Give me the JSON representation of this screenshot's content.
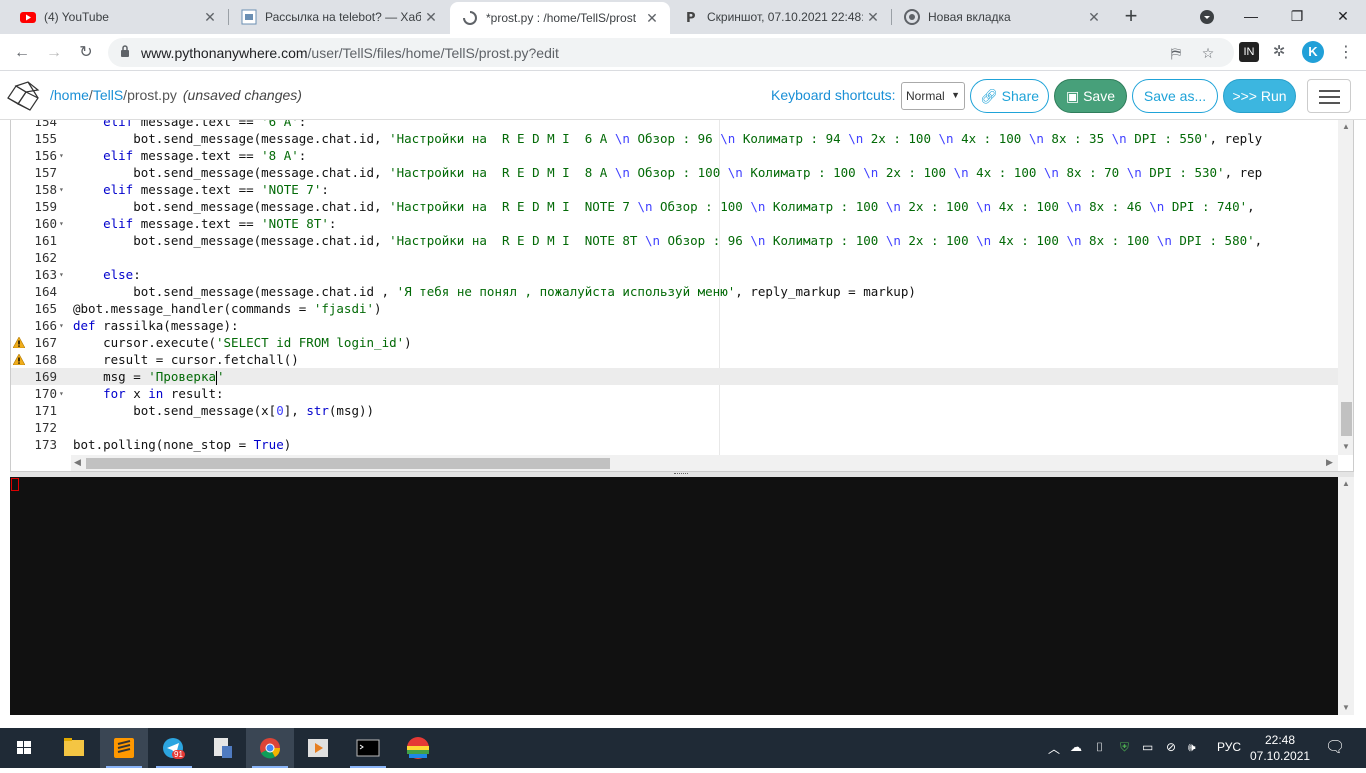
{
  "browser": {
    "tabs": [
      {
        "title": "(4) YouTube",
        "favicon": "youtube-icon"
      },
      {
        "title": "Рассылка на telebot? — Хабр",
        "favicon": "habr-icon"
      },
      {
        "title": "*prost.py : /home/TellS/prost",
        "favicon": "loading-icon"
      },
      {
        "title": "Скриншот, 07.10.2021 22:48:",
        "favicon": "p-icon"
      },
      {
        "title": "Новая вкладка",
        "favicon": "chrome-icon"
      }
    ],
    "new_tab": "+",
    "url_host": "www.pythonanywhere.com",
    "url_path": "/user/TellS/files/home/TellS/prost.py?edit",
    "profile_initial": "K",
    "ext_label": "IN"
  },
  "header": {
    "path_home": "/home",
    "path_user": "TellS",
    "path_file": "prost.py",
    "unsaved": "(unsaved changes)",
    "kb_label": "Keyboard shortcuts:",
    "kb_value": "Normal",
    "share": "Share",
    "save": "Save",
    "save_as": "Save as...",
    "run": ">>> Run"
  },
  "editor": {
    "lines": [
      {
        "n": "154",
        "fold": false,
        "warn": false,
        "html": "    <span class='kw'>elif</span> message.text == <span class='str'>'6 A'</span>:"
      },
      {
        "n": "155",
        "fold": false,
        "warn": false,
        "html": "        bot.send_message(message.chat.id, <span class='str'>'Настройки на  R E D M I  6 A <span class=\"esc\">\\n</span> Обзор : 96 <span class=\"esc\">\\n</span> Колиматр : 94 <span class=\"esc\">\\n</span> 2x : 100 <span class=\"esc\">\\n</span> 4x : 100 <span class=\"esc\">\\n</span> 8x : 35 <span class=\"esc\">\\n</span> DPI : 550'</span>, reply"
      },
      {
        "n": "156",
        "fold": true,
        "warn": false,
        "html": "    <span class='kw'>elif</span> message.text == <span class='str'>'8 A'</span>:"
      },
      {
        "n": "157",
        "fold": false,
        "warn": false,
        "html": "        bot.send_message(message.chat.id, <span class='str'>'Настройки на  R E D M I  8 A <span class=\"esc\">\\n</span> Обзор : 100 <span class=\"esc\">\\n</span> Колиматр : 100 <span class=\"esc\">\\n</span> 2x : 100 <span class=\"esc\">\\n</span> 4x : 100 <span class=\"esc\">\\n</span> 8x : 70 <span class=\"esc\">\\n</span> DPI : 530'</span>, rep"
      },
      {
        "n": "158",
        "fold": true,
        "warn": false,
        "html": "    <span class='kw'>elif</span> message.text == <span class='str'>'NOTE 7'</span>:"
      },
      {
        "n": "159",
        "fold": false,
        "warn": false,
        "html": "        bot.send_message(message.chat.id, <span class='str'>'Настройки на  R E D M I  NOTE 7 <span class=\"esc\">\\n</span> Обзор : 100 <span class=\"esc\">\\n</span> Колиматр : 100 <span class=\"esc\">\\n</span> 2x : 100 <span class=\"esc\">\\n</span> 4x : 100 <span class=\"esc\">\\n</span> 8x : 46 <span class=\"esc\">\\n</span> DPI : 740'</span>,"
      },
      {
        "n": "160",
        "fold": true,
        "warn": false,
        "html": "    <span class='kw'>elif</span> message.text == <span class='str'>'NOTE 8T'</span>:"
      },
      {
        "n": "161",
        "fold": false,
        "warn": false,
        "html": "        bot.send_message(message.chat.id, <span class='str'>'Настройки на  R E D M I  NOTE 8T <span class=\"esc\">\\n</span> Обзор : 96 <span class=\"esc\">\\n</span> Колиматр : 100 <span class=\"esc\">\\n</span> 2x : 100 <span class=\"esc\">\\n</span> 4x : 100 <span class=\"esc\">\\n</span> 8x : 100 <span class=\"esc\">\\n</span> DPI : 580'</span>,"
      },
      {
        "n": "162",
        "fold": false,
        "warn": false,
        "html": ""
      },
      {
        "n": "163",
        "fold": true,
        "warn": false,
        "html": "    <span class='kw'>else</span>:"
      },
      {
        "n": "164",
        "fold": false,
        "warn": false,
        "html": "        bot.send_message(message.chat.id , <span class='str'>'Я тебя не понял , пожалуйста используй меню'</span>, reply_markup = markup)"
      },
      {
        "n": "165",
        "fold": false,
        "warn": false,
        "html": "@bot.message_handler(commands = <span class='str'>'fjasdi'</span>)"
      },
      {
        "n": "166",
        "fold": true,
        "warn": false,
        "html": "<span class='kw'>def</span> rassilka(message):"
      },
      {
        "n": "167",
        "fold": false,
        "warn": true,
        "html": "    cursor.execute(<span class='str'>'SELECT id FROM login_id'</span>)"
      },
      {
        "n": "168",
        "fold": false,
        "warn": true,
        "html": "    result = cursor.fetchall()"
      },
      {
        "n": "169",
        "fold": false,
        "warn": false,
        "active": true,
        "html": "    msg = <span class='str'>'Проверка<span class=\"cursor\"></span>'</span>"
      },
      {
        "n": "170",
        "fold": true,
        "warn": false,
        "html": "    <span class='kw'>for</span> x <span class='kw'>in</span> result:"
      },
      {
        "n": "171",
        "fold": false,
        "warn": false,
        "html": "        bot.send_message(x[<span class='esc'>0</span>], <span class='kw'>str</span>(msg))"
      },
      {
        "n": "172",
        "fold": false,
        "warn": false,
        "html": ""
      },
      {
        "n": "173",
        "fold": false,
        "warn": false,
        "html": "bot.polling(none_stop = <span class='kw'>True</span>)"
      }
    ]
  },
  "taskbar": {
    "telegram_badge": "91",
    "lang": "РУС",
    "time": "22:48",
    "date": "07.10.2021"
  }
}
